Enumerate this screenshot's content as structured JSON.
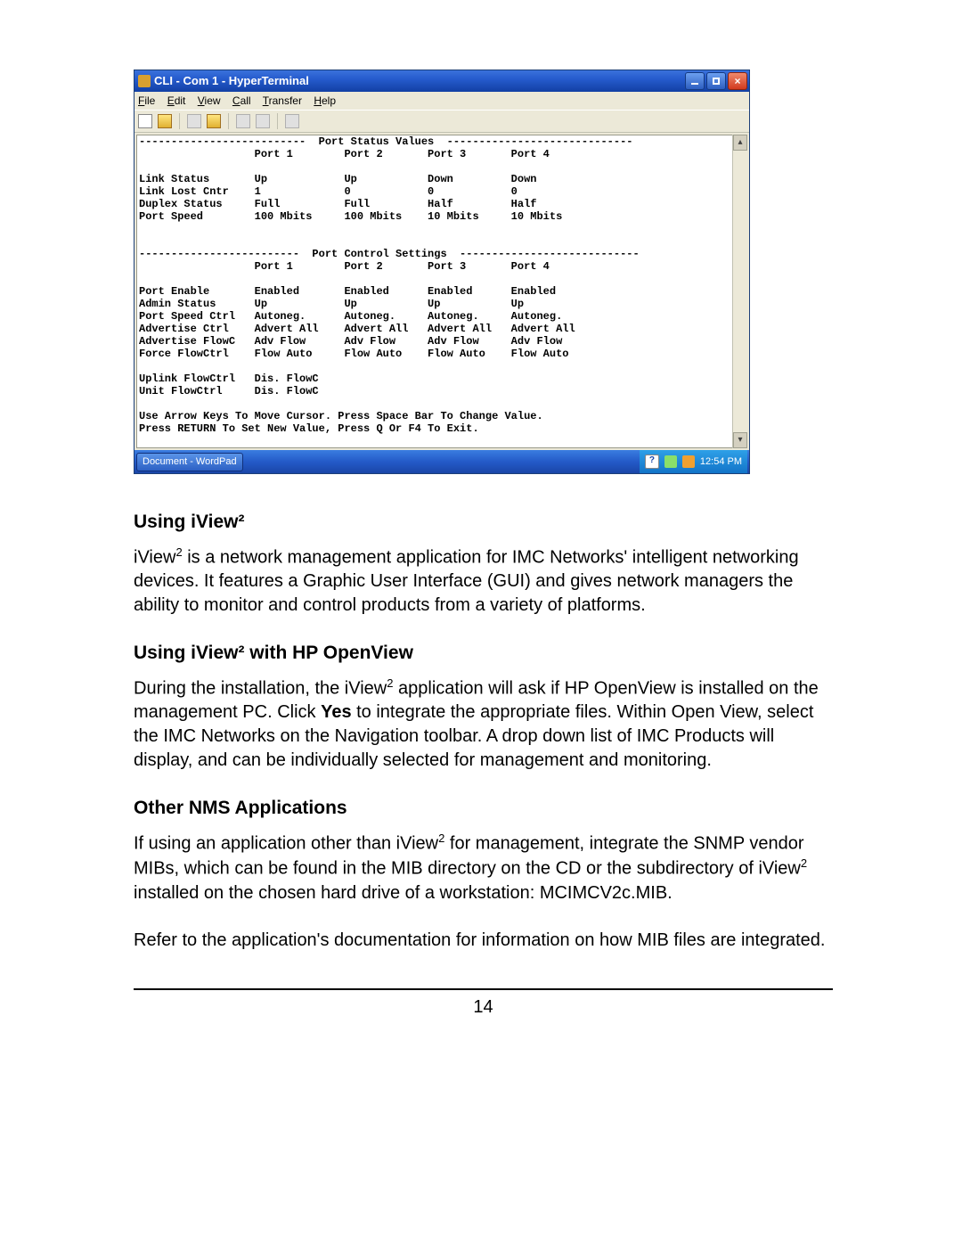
{
  "window": {
    "title": "CLI - Com 1 - HyperTerminal",
    "menus": [
      "File",
      "Edit",
      "View",
      "Call",
      "Transfer",
      "Help"
    ],
    "terminal": "--------------------------  Port Status Values  -----------------------------\n                  Port 1        Port 2       Port 3       Port 4\n\nLink Status       Up            Up           Down         Down\nLink Lost Cntr    1             0            0            0\nDuplex Status     Full          Full         Half         Half\nPort Speed        100 Mbits     100 Mbits    10 Mbits     10 Mbits\n\n\n-------------------------  Port Control Settings  ----------------------------\n                  Port 1        Port 2       Port 3       Port 4\n\nPort Enable       Enabled       Enabled      Enabled      Enabled\nAdmin Status      Up            Up           Up           Up\nPort Speed Ctrl   Autoneg.      Autoneg.     Autoneg.     Autoneg.\nAdvertise Ctrl    Advert All    Advert All   Advert All   Advert All\nAdvertise FlowC   Adv Flow      Adv Flow     Adv Flow     Adv Flow\nForce FlowCtrl    Flow Auto     Flow Auto    Flow Auto    Flow Auto\n\nUplink FlowCtrl   Dis. FlowC\nUnit FlowCtrl     Dis. FlowC\n\nUse Arrow Keys To Move Cursor. Press Space Bar To Change Value.\nPress RETURN To Set New Value, Press Q Or F4 To Exit.",
    "taskbar_item": "Document - WordPad",
    "clock": "12:54 PM"
  },
  "sections": {
    "s1": {
      "heading": "Using iView²",
      "p1a": "iView",
      "p1b": " is a network management application for IMC Networks' intelligent networking devices.  It features a Graphic User Interface (GUI) and gives network managers the ability to monitor and control products from a variety of platforms."
    },
    "s2": {
      "heading": "Using iView² with HP OpenView",
      "p1a": "During the installation, the iView",
      "p1b": " application will ask if HP OpenView is installed on the management PC.  Click ",
      "p1_bold": "Yes",
      "p1c": " to integrate the appropriate files.  Within Open View, select the IMC Networks on the Navigation toolbar.  A drop down list of IMC Products will display, and can be individually selected for management and monitoring."
    },
    "s3": {
      "heading": "Other NMS Applications",
      "p1a": "If using an application other than iView",
      "p1b": " for management, integrate the SNMP vendor MIBs, which can be found in the MIB directory on the CD or the subdirectory of iView",
      "p1c": " installed on the chosen hard drive of a workstation: MCIMCV2c.MIB.",
      "p2": "Refer to the application's documentation for information on how MIB files are integrated."
    }
  },
  "page_number": "14"
}
